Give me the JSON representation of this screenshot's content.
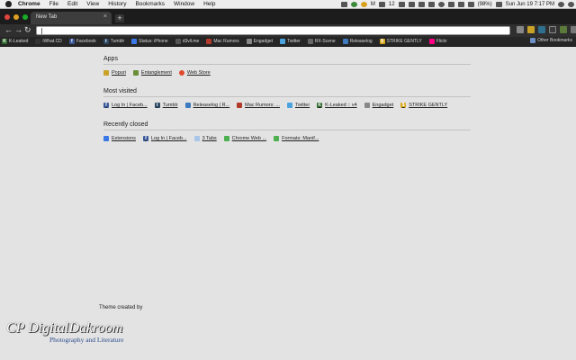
{
  "menubar": {
    "app": "Chrome",
    "items": [
      "File",
      "Edit",
      "View",
      "History",
      "Bookmarks",
      "Window",
      "Help"
    ],
    "status_m": "M",
    "status_count": "12",
    "battery": "(98%)",
    "clock": "Sun Jun 19  7:17 PM"
  },
  "tab": {
    "title": "New Tab"
  },
  "bookmarks": [
    {
      "label": "K-Leaked",
      "icon": "K",
      "color": "#2e6b2e"
    },
    {
      "label": "iWhat.CD",
      "icon": "",
      "color": "#333333"
    },
    {
      "label": "Facebook",
      "icon": "f",
      "color": "#3b5998"
    },
    {
      "label": "Tumblr",
      "icon": "t",
      "color": "#2c4762"
    },
    {
      "label": "Status: iPhone",
      "icon": "",
      "color": "#3b78e7"
    },
    {
      "label": "d3vil.me",
      "icon": "",
      "color": "#555555"
    },
    {
      "label": "Mac Rumors",
      "icon": "",
      "color": "#b33b2c"
    },
    {
      "label": "Engadget",
      "icon": "",
      "color": "#888888"
    },
    {
      "label": "Twitter",
      "icon": "",
      "color": "#4aa3df"
    },
    {
      "label": "RX-Scene",
      "icon": "",
      "color": "#666666"
    },
    {
      "label": "Releaselog",
      "icon": "",
      "color": "#3c7bbf"
    },
    {
      "label": "STRIKE GENTLY",
      "icon": "$",
      "color": "#d8a71f"
    },
    {
      "label": "Flickr",
      "icon": "",
      "color": "#ff0084"
    }
  ],
  "other_bookmarks": "Other Bookmarks",
  "apps": {
    "heading": "Apps",
    "items": [
      {
        "label": "Popuri",
        "color": "#c9a227"
      },
      {
        "label": "Entanglement",
        "color": "#6a8f3a"
      },
      {
        "label": "Web Store",
        "color": "#e04a2f"
      }
    ]
  },
  "most_visited": {
    "heading": "Most visited",
    "items": [
      {
        "label": "Log In | Faceb...",
        "icon": "f",
        "color": "#3b5998"
      },
      {
        "label": "Tumblr",
        "icon": "t",
        "color": "#2c4762"
      },
      {
        "label": "Releaselog | R...",
        "icon": "",
        "color": "#3c7bbf"
      },
      {
        "label": "Mac Rumors: ...",
        "icon": "",
        "color": "#b33b2c"
      },
      {
        "label": "Twitter",
        "icon": "",
        "color": "#4aa3df"
      },
      {
        "label": "K-Leaked :: v4",
        "icon": "K",
        "color": "#2e6b2e"
      },
      {
        "label": "Engadget",
        "icon": "",
        "color": "#888888"
      },
      {
        "label": "STRIKE GENTLY",
        "icon": "$",
        "color": "#d8a71f"
      }
    ]
  },
  "recently_closed": {
    "heading": "Recently closed",
    "items": [
      {
        "label": "Extensions",
        "icon": "",
        "color": "#3b78e7"
      },
      {
        "label": "Log In | Faceb...",
        "icon": "f",
        "color": "#3b5998"
      },
      {
        "label": "3 Tabs",
        "icon": "",
        "color": "#a9c5e8"
      },
      {
        "label": "Chrome Web ...",
        "icon": "",
        "color": "#4caf50"
      },
      {
        "label": "Formats: Manif...",
        "icon": "",
        "color": "#4caf50"
      }
    ]
  },
  "theme_credit": "Theme created by",
  "logo": {
    "main": "CP DigitalDakroom",
    "sub": "Photography and Literature"
  }
}
